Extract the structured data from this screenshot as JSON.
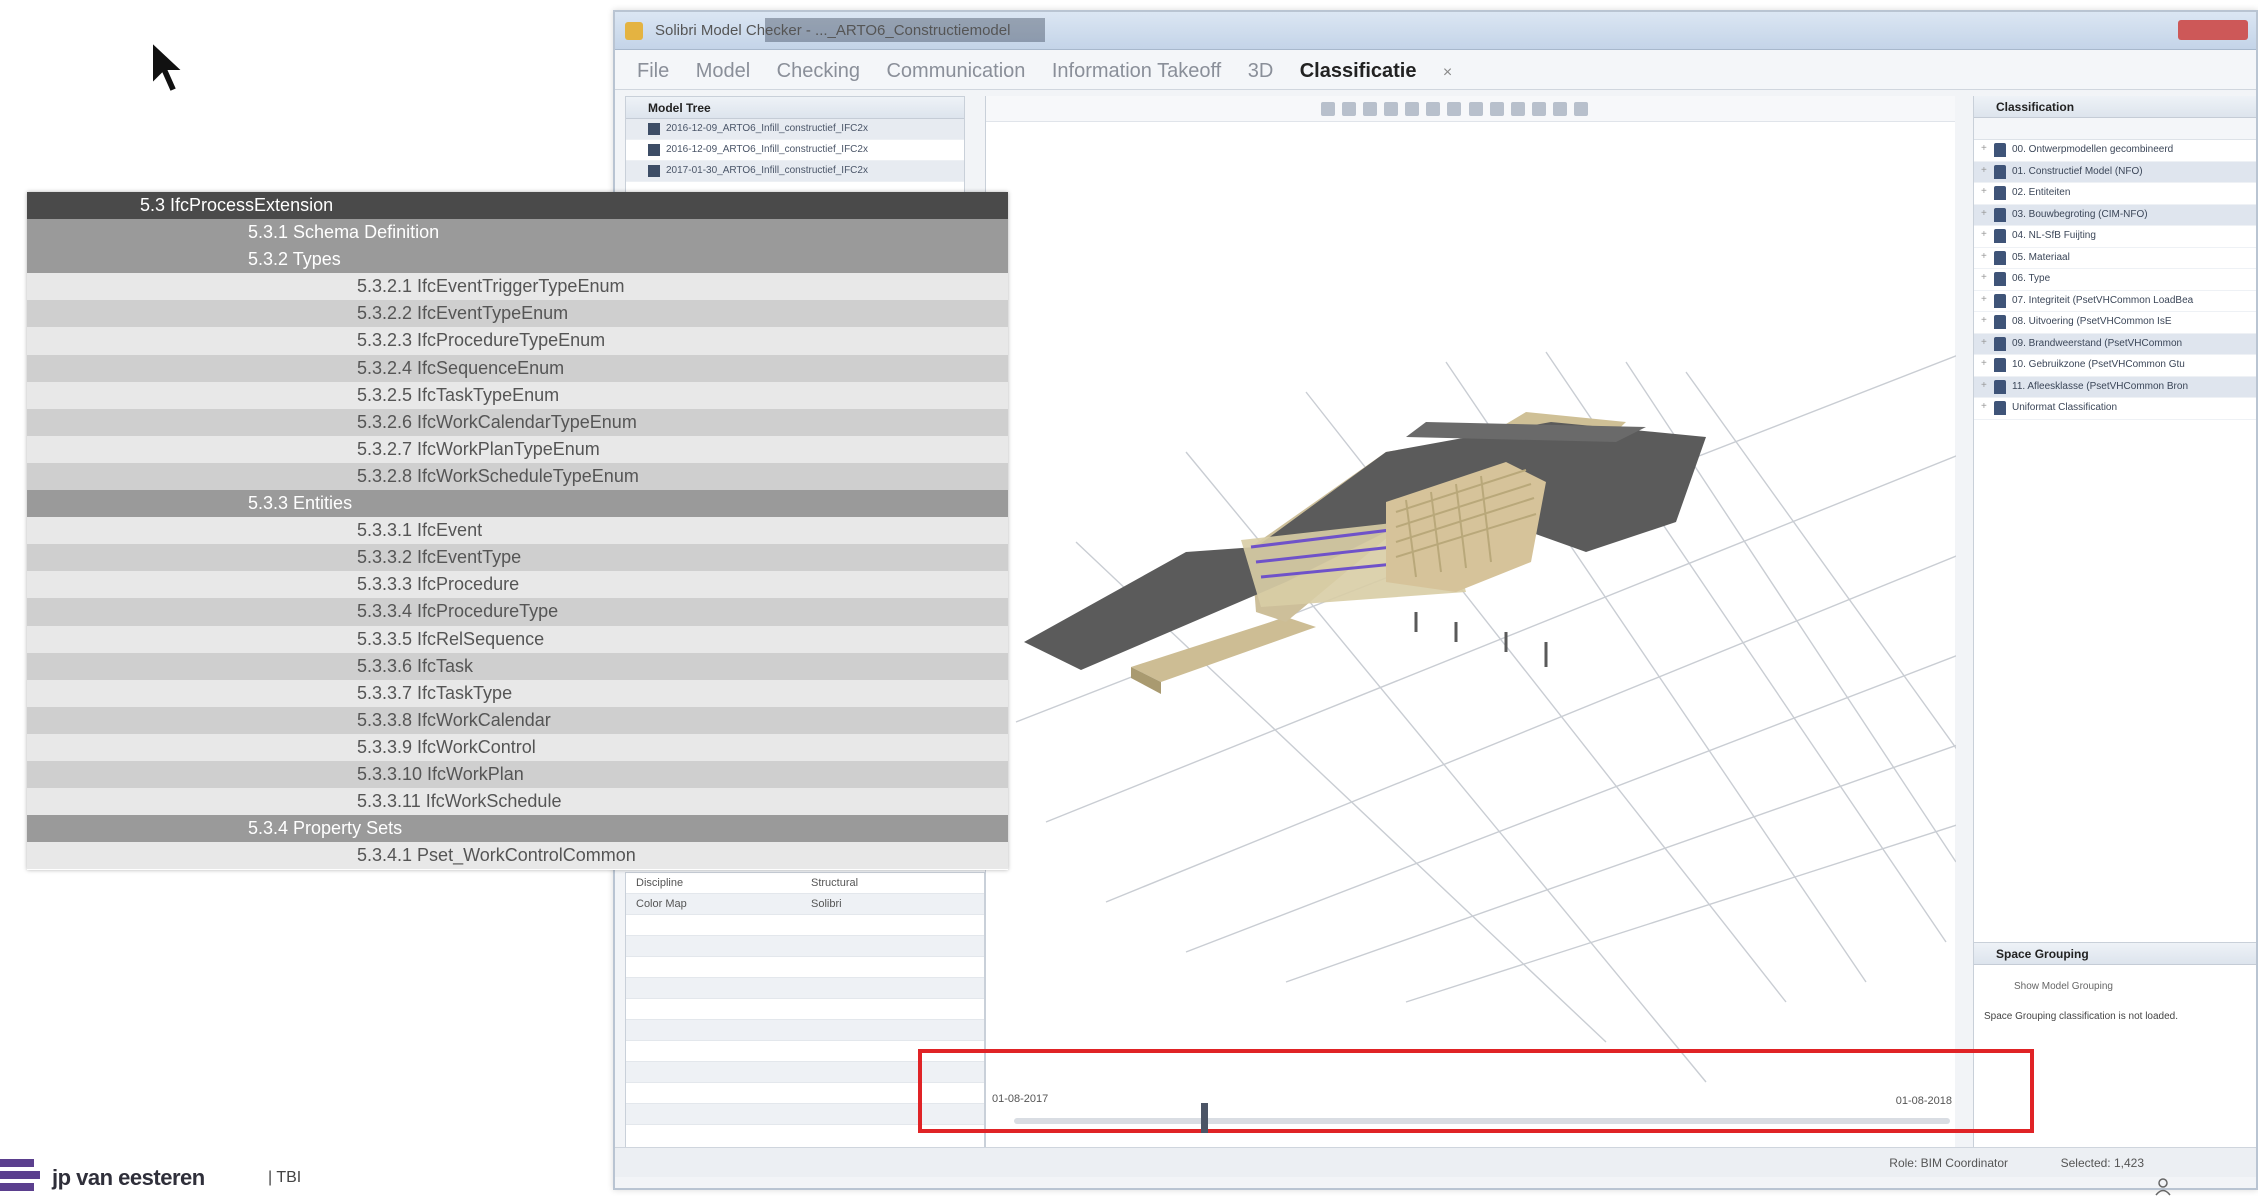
{
  "window": {
    "title": "Solibri Model Checker - ..._ARTO6_Constructiemodel",
    "menu": [
      "File",
      "Model",
      "Checking",
      "Communication",
      "Information Takeoff",
      "3D",
      "Classificatie"
    ],
    "active_menu": "Classificatie",
    "close_tab": "×"
  },
  "model_tree": {
    "title": "Model Tree",
    "items": [
      "2016-12-09_ARTO6_Infill_constructief_IFC2x",
      "2016-12-09_ARTO6_Infill_constructief_IFC2x",
      "2017-01-30_ARTO6_Infill_constructief_IFC2x"
    ]
  },
  "properties": {
    "rows": [
      {
        "key": "Discipline",
        "value": "Structural"
      },
      {
        "key": "Color Map",
        "value": "Solibri"
      }
    ]
  },
  "classification": {
    "title": "Classification",
    "items": [
      "00. Ontwerpmodellen gecombineerd",
      "01. Constructief Model (NFO)",
      "02. Entiteiten",
      "03. Bouwbegroting (CIM-NFO)",
      "04. NL-SfB Fuijting",
      "05. Materiaal",
      "06. Type",
      "07. Integriteit (PsetVHCommon LoadBea",
      "08. Uitvoering (PsetVHCommon IsE",
      "09. Brandweerstand (PsetVHCommon",
      "10. Gebruikzone (PsetVHCommon Gtu",
      "11. Afleesklasse (PsetVHCommon Bron",
      "Uniformat Classification"
    ],
    "selected_indices": [
      1,
      3,
      9,
      11
    ]
  },
  "space_grouping": {
    "title": "Space Grouping",
    "checkbox_label": "Show Model Grouping",
    "note": "Space Grouping classification is not loaded."
  },
  "status": {
    "role": "Role: BIM Coordinator",
    "selected": "Selected: 1,423"
  },
  "timeline": {
    "start_date": "01-08-2017",
    "end_date": "01-08-2018",
    "position_fraction": 0.2
  },
  "ifc_table": {
    "rows": [
      {
        "level": 0,
        "text": "5.3 IfcProcessExtension"
      },
      {
        "level": 1,
        "text": "5.3.1 Schema Definition"
      },
      {
        "level": 1,
        "text": "5.3.2 Types"
      },
      {
        "level": 2,
        "text": "5.3.2.1 IfcEventTriggerTypeEnum"
      },
      {
        "level": 2,
        "text": "5.3.2.2 IfcEventTypeEnum"
      },
      {
        "level": 2,
        "text": "5.3.2.3 IfcProcedureTypeEnum"
      },
      {
        "level": 2,
        "text": "5.3.2.4 IfcSequenceEnum"
      },
      {
        "level": 2,
        "text": "5.3.2.5 IfcTaskTypeEnum"
      },
      {
        "level": 2,
        "text": "5.3.2.6 IfcWorkCalendarTypeEnum"
      },
      {
        "level": 2,
        "text": "5.3.2.7 IfcWorkPlanTypeEnum"
      },
      {
        "level": 2,
        "text": "5.3.2.8 IfcWorkScheduleTypeEnum"
      },
      {
        "level": 1,
        "text": "5.3.3 Entities"
      },
      {
        "level": 2,
        "text": "5.3.3.1 IfcEvent"
      },
      {
        "level": 2,
        "text": "5.3.3.2 IfcEventType"
      },
      {
        "level": 2,
        "text": "5.3.3.3 IfcProcedure"
      },
      {
        "level": 2,
        "text": "5.3.3.4 IfcProcedureType"
      },
      {
        "level": 2,
        "text": "5.3.3.5 IfcRelSequence"
      },
      {
        "level": 2,
        "text": "5.3.3.6 IfcTask"
      },
      {
        "level": 2,
        "text": "5.3.3.7 IfcTaskType"
      },
      {
        "level": 2,
        "text": "5.3.3.8 IfcWorkCalendar"
      },
      {
        "level": 2,
        "text": "5.3.3.9 IfcWorkControl"
      },
      {
        "level": 2,
        "text": "5.3.3.10 IfcWorkPlan"
      },
      {
        "level": 2,
        "text": "5.3.3.11 IfcWorkSchedule"
      },
      {
        "level": 1,
        "text": "5.3.4 Property Sets"
      },
      {
        "level": 2,
        "text": "5.3.4.1 Pset_WorkControlCommon"
      }
    ]
  },
  "logo": {
    "name": "jp van eesteren",
    "sub": "| TBI"
  },
  "colors": {
    "highlight": "#e02326",
    "roof": "#555555",
    "structure": "#cfc096",
    "beams": "#7a5ccd"
  }
}
